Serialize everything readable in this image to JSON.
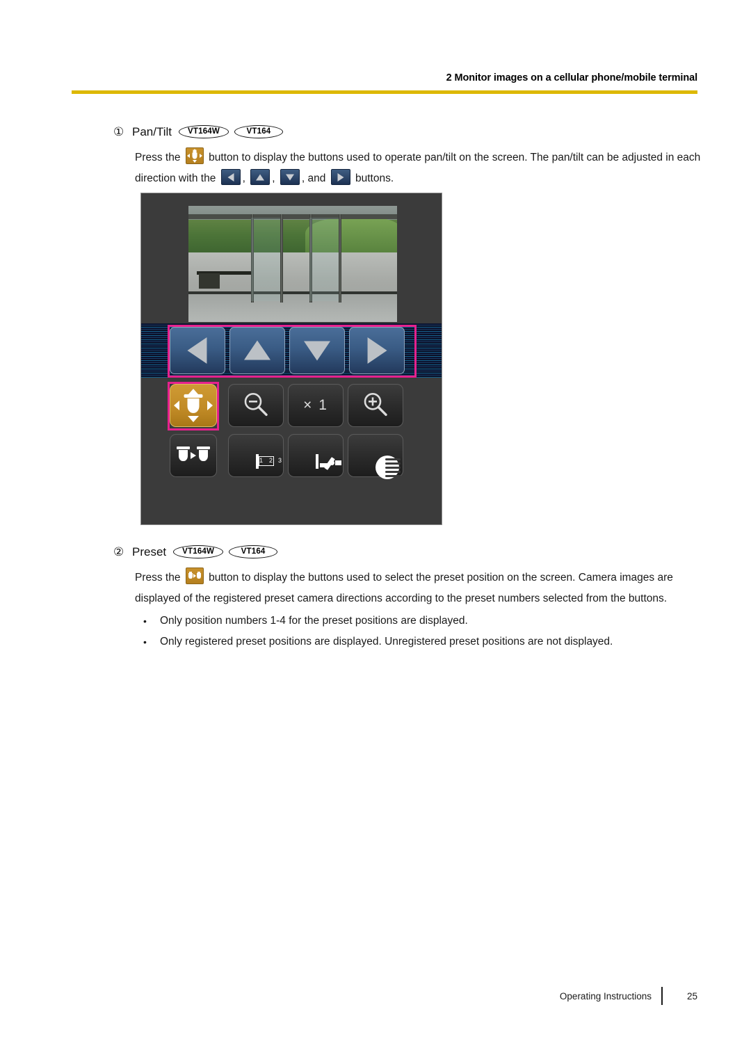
{
  "header": {
    "title": "2 Monitor images on a cellular phone/mobile terminal",
    "rule_color": "#ddb800"
  },
  "sections": [
    {
      "number": "①",
      "title": "Pan/Tilt",
      "badges": [
        "VT164W",
        "VT164"
      ],
      "body_part_1": "Press the",
      "body_part_2": "button to display the buttons used to operate pan/tilt on the screen. The pan/tilt can be adjusted in each direction with the",
      "body_part_3": ",",
      "body_part_4": ",",
      "body_part_5": ", and",
      "body_part_6": "buttons."
    },
    {
      "number": "②",
      "title": "Preset",
      "badges": [
        "VT164W",
        "VT164"
      ],
      "body_part_1": "Press the",
      "body_part_2": "button to display the buttons used to select the preset position on the screen. Camera images are displayed of the registered preset camera directions according to the preset numbers selected from the buttons.",
      "bullets": [
        "Only position numbers 1-4 for the preset positions are displayed.",
        "Only registered preset positions are displayed. Unregistered preset positions are not displayed."
      ]
    }
  ],
  "device_screenshot": {
    "video_description": "Live camera view of a glass-door building entrance with green hedges and a paved walkway",
    "arrow_buttons": [
      "left",
      "up",
      "down",
      "right"
    ],
    "pan_tilt_button": "pan-tilt",
    "zoom_out_button": "zoom-out",
    "zoom_level_label": "× 1",
    "zoom_in_button": "zoom-in",
    "misc_buttons": [
      "preset",
      "resolution",
      "aux",
      "brightness"
    ],
    "resolution_icon_numbers": [
      "1",
      "2",
      "3"
    ],
    "highlight_color": "#e6218d",
    "panel_background": "#3b3b3b",
    "gold_button_color": "#c08a26",
    "blue_button_color": "#3a5c85"
  },
  "footer": {
    "label": "Operating Instructions",
    "page": "25"
  }
}
